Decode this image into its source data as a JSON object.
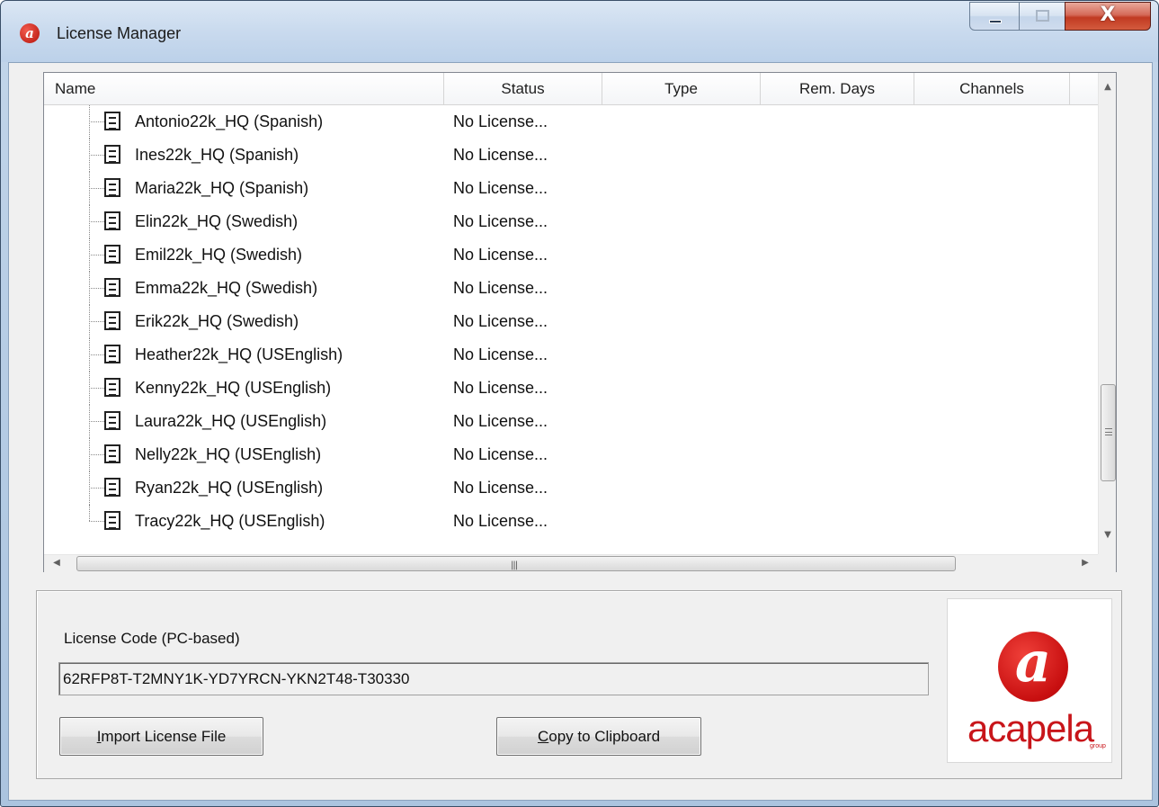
{
  "window": {
    "title": "License Manager",
    "close_glyph": "X"
  },
  "list": {
    "columns": [
      "Name",
      "Status",
      "Type",
      "Rem. Days",
      "Channels"
    ],
    "rows": [
      {
        "name": "Antonio22k_HQ (Spanish)",
        "status": "No License..."
      },
      {
        "name": "Ines22k_HQ (Spanish)",
        "status": "No License..."
      },
      {
        "name": "Maria22k_HQ (Spanish)",
        "status": "No License..."
      },
      {
        "name": "Elin22k_HQ (Swedish)",
        "status": "No License..."
      },
      {
        "name": "Emil22k_HQ (Swedish)",
        "status": "No License..."
      },
      {
        "name": "Emma22k_HQ (Swedish)",
        "status": "No License..."
      },
      {
        "name": "Erik22k_HQ (Swedish)",
        "status": "No License..."
      },
      {
        "name": "Heather22k_HQ (USEnglish)",
        "status": "No License..."
      },
      {
        "name": "Kenny22k_HQ (USEnglish)",
        "status": "No License..."
      },
      {
        "name": "Laura22k_HQ (USEnglish)",
        "status": "No License..."
      },
      {
        "name": "Nelly22k_HQ (USEnglish)",
        "status": "No License..."
      },
      {
        "name": "Ryan22k_HQ (USEnglish)",
        "status": "No License..."
      },
      {
        "name": "Tracy22k_HQ (USEnglish)",
        "status": "No License..."
      }
    ],
    "row_icon": "document-list-icon"
  },
  "license": {
    "label": "License Code (PC-based)",
    "code": "62RFP8T-T2MNY1K-YD7YRCN-YKN2T48-T30330"
  },
  "buttons": {
    "import": {
      "mnemonic": "I",
      "rest": "mport License File"
    },
    "copy": {
      "mnemonic": "C",
      "rest": "opy to Clipboard"
    }
  },
  "logo": {
    "mark": "a",
    "word": "acapela",
    "sub": "group"
  },
  "colors": {
    "brand_red": "#c8151a",
    "title_bar": "#c9daee"
  }
}
